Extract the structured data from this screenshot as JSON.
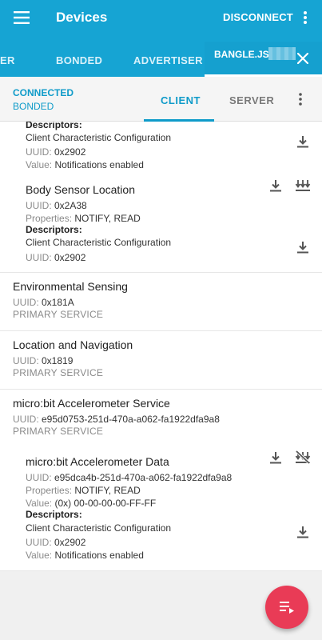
{
  "appbar": {
    "title": "Devices",
    "disconnect_label": "DISCONNECT",
    "icons": {
      "menu": "hamburger-menu-icon",
      "overflow": "vertical-dots-icon",
      "close": "close-x-icon"
    }
  },
  "device_tabs": [
    {
      "label": "ER"
    },
    {
      "label": "BONDED"
    },
    {
      "label": "ADVERTISER"
    },
    {
      "label": "BANGLE.JS"
    }
  ],
  "connection": {
    "status": "CONNECTED",
    "bond": "BONDED"
  },
  "sub_tabs": [
    {
      "label": "CLIENT"
    },
    {
      "label": "SERVER"
    }
  ],
  "labels": {
    "descriptors": "Descriptors:",
    "uuid": "UUID: ",
    "properties": "Properties: ",
    "value": "Value: ",
    "primary_service": "PRIMARY SERVICE"
  },
  "items": {
    "top_descriptor": {
      "name": "Client Characteristic Configuration",
      "uuid": "0x2902",
      "value": "Notifications enabled"
    },
    "body_sensor": {
      "name": "Body Sensor Location",
      "uuid": "0x2A38",
      "properties": "NOTIFY, READ",
      "descriptor_name": "Client Characteristic Configuration",
      "descriptor_uuid": "0x2902"
    },
    "env_service": {
      "name": "Environmental Sensing",
      "uuid": "0x181A"
    },
    "loc_service": {
      "name": "Location and Navigation",
      "uuid": "0x1819"
    },
    "mb_service": {
      "name": "micro:bit Accelerometer Service",
      "uuid": "e95d0753-251d-470a-a062-fa1922dfa9a8"
    },
    "mb_char": {
      "name": "micro:bit Accelerometer Data",
      "uuid": "e95dca4b-251d-470a-a062-fa1922dfa9a8",
      "properties": "NOTIFY, READ",
      "value": "(0x) 00-00-00-00-FF-FF",
      "descriptor_name": "Client Characteristic Configuration",
      "descriptor_uuid": "0x2902",
      "descriptor_value": "Notifications enabled"
    }
  },
  "colors": {
    "primary": "#16a4d3",
    "accent": "#0f9bc9",
    "fab": "#e93b56"
  }
}
